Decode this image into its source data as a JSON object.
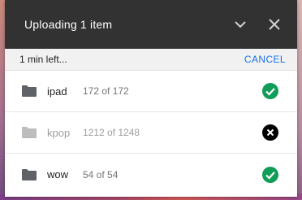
{
  "header": {
    "title": "Uploading 1 item",
    "collapse_icon": "chevron-down-icon",
    "close_icon": "close-icon"
  },
  "progress": {
    "time_left": "1 min left...",
    "cancel_label": "CANCEL"
  },
  "items": [
    {
      "name": "ipad",
      "count": "172 of 172",
      "status": "complete",
      "icon": "check-circle-icon"
    },
    {
      "name": "kpop",
      "count": "1212 of 1248",
      "status": "failed",
      "icon": "cancel-circle-icon"
    },
    {
      "name": "wow",
      "count": "54 of 54",
      "status": "complete",
      "icon": "check-circle-icon"
    }
  ],
  "colors": {
    "header_bg": "#323232",
    "accent": "#1a73e8",
    "success": "#0f9d58",
    "error": "#000000"
  }
}
